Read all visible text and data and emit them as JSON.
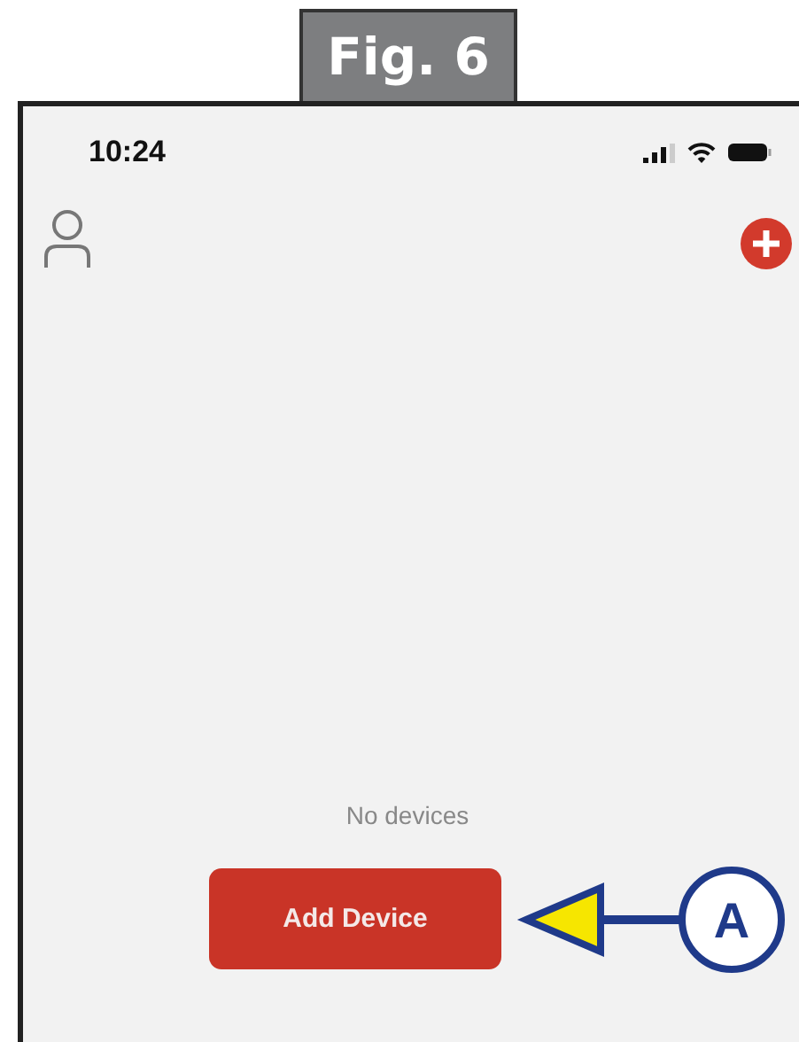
{
  "figure_label": "Fig. 6",
  "status_bar": {
    "time": "10:24"
  },
  "empty_state": {
    "message": "No devices",
    "button": "Add Device"
  },
  "callout": {
    "label": "A"
  }
}
